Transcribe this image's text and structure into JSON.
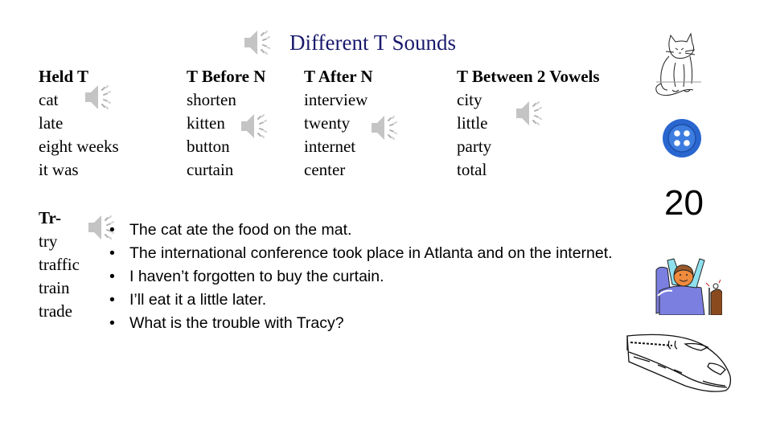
{
  "slide": {
    "title": "Different T Sounds",
    "slide_number": "20",
    "columns": [
      {
        "header": "Held T",
        "words": [
          "cat",
          "late",
          "eight weeks",
          "it was"
        ]
      },
      {
        "header": "T Before N",
        "words": [
          "shorten",
          "kitten",
          "button",
          "curtain"
        ]
      },
      {
        "header": "T After N",
        "words": [
          "interview",
          "twenty",
          "internet",
          "center"
        ]
      },
      {
        "header": "T Between 2 Vowels",
        "words": [
          "city",
          "little",
          "party",
          "total"
        ]
      }
    ],
    "tr_group": {
      "header": "Tr-",
      "words": [
        "try",
        "traffic",
        "train",
        "trade"
      ]
    },
    "sentences": [
      "The cat ate the food on the mat.",
      "The international conference took place in Atlanta and on the internet.",
      "I haven’t forgotten to buy the curtain.",
      "I’ll eat it a little later.",
      "What is the trouble with Tracy?"
    ],
    "images": {
      "cat": "cat-drawing",
      "button": "blue-button",
      "waking": "person-waking-in-bed",
      "train": "bullet-train-drawing"
    },
    "colors": {
      "title": "#1a1a6e",
      "button_blue": "#2f6fd6",
      "bed_purple": "#7b7fe0"
    }
  }
}
